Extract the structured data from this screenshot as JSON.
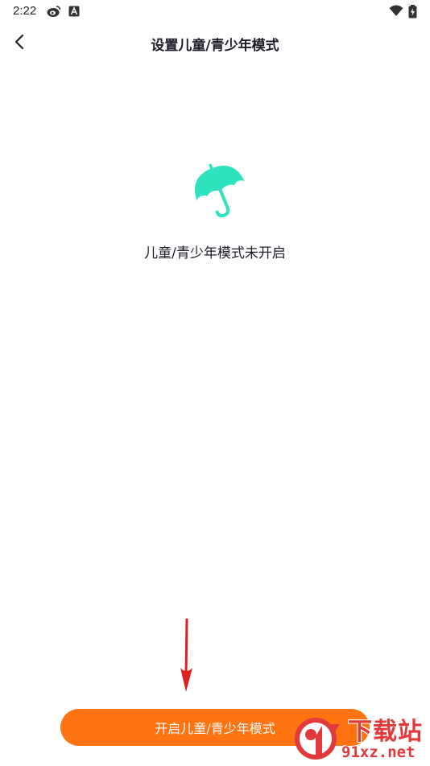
{
  "status_bar": {
    "time": "2:22",
    "icons": [
      "weibo-icon",
      "a-badge-icon",
      "wifi-icon",
      "battery-charging-icon"
    ]
  },
  "header": {
    "title": "设置儿童/青少年模式",
    "back_icon": "chevron-left-icon"
  },
  "main": {
    "icon": "umbrella-icon",
    "icon_color": "#2ee3be",
    "status_text": "儿童/青少年模式未开启"
  },
  "footer": {
    "button_label": "开启儿童/青少年模式",
    "button_color": "#ff7412"
  },
  "annotation": {
    "arrow_color": "#e02020"
  },
  "watermark": {
    "top_text": "下载站",
    "bottom_text": "91xz.net",
    "color": "#e23a3a"
  }
}
